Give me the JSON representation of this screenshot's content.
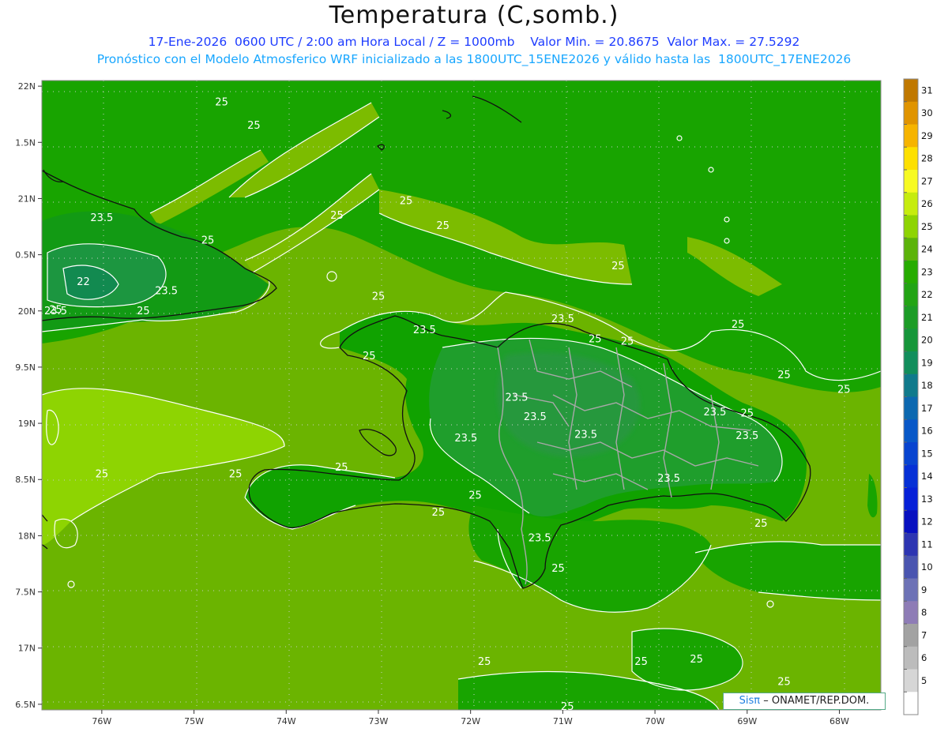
{
  "header": {
    "title": "Temperatura (C,somb.)",
    "subtitle1": "17-Ene-2026  0600 UTC / 2:00 am Hora Local / Z = 1000mb    Valor Min. = 20.8675  Valor Max. = 27.5292",
    "subtitle2": "Pronóstico con el Modelo Atmosferico WRF inicializado a las 1800UTC_15ENE2026 y válido hasta las  1800UTC_17ENE2026"
  },
  "map": {
    "lon_range": [
      -76.65,
      -67.55
    ],
    "lat_range": [
      16.45,
      22.05
    ],
    "lat_ticks": [
      "22N",
      "1.5N",
      "21N",
      "0.5N",
      "20N",
      "9.5N",
      "19N",
      "8.5N",
      "18N",
      "7.5N",
      "17N",
      "6.5N"
    ],
    "lat_tick_values": [
      22,
      21.5,
      21,
      20.5,
      20,
      19.5,
      19,
      18.5,
      18,
      17.5,
      17,
      16.5
    ],
    "lon_ticks": [
      "76W",
      "75W",
      "74W",
      "73W",
      "72W",
      "71W",
      "70W",
      "69W",
      "68W"
    ],
    "lon_tick_values": [
      -76,
      -75,
      -74,
      -73,
      -72,
      -71,
      -70,
      -69,
      -68
    ],
    "contour_labels": [
      {
        "text": "25",
        "lon": -74.7,
        "lat": 21.83
      },
      {
        "text": "25",
        "lon": -74.35,
        "lat": 21.62
      },
      {
        "text": "25",
        "lon": -72.7,
        "lat": 20.95
      },
      {
        "text": "25",
        "lon": -72.3,
        "lat": 20.73
      },
      {
        "text": "25",
        "lon": -73.45,
        "lat": 20.82
      },
      {
        "text": "25",
        "lon": -74.85,
        "lat": 20.6
      },
      {
        "text": "23.5",
        "lon": -76.0,
        "lat": 20.8
      },
      {
        "text": "22",
        "lon": -76.2,
        "lat": 20.23
      },
      {
        "text": "23.5",
        "lon": -75.3,
        "lat": 20.15
      },
      {
        "text": "25",
        "lon": -75.55,
        "lat": 19.97
      },
      {
        "text": "23.5",
        "lon": -76.5,
        "lat": 19.97
      },
      {
        "text": "25",
        "lon": -76.5,
        "lat": 19.98
      },
      {
        "text": "25",
        "lon": -73.0,
        "lat": 20.1
      },
      {
        "text": "23.5",
        "lon": -72.5,
        "lat": 19.8
      },
      {
        "text": "25",
        "lon": -73.1,
        "lat": 19.57
      },
      {
        "text": "23.5",
        "lon": -71.0,
        "lat": 19.9
      },
      {
        "text": "25",
        "lon": -69.1,
        "lat": 19.85
      },
      {
        "text": "25",
        "lon": -70.65,
        "lat": 19.72
      },
      {
        "text": "25",
        "lon": -70.4,
        "lat": 20.37
      },
      {
        "text": "25",
        "lon": -70.3,
        "lat": 19.7
      },
      {
        "text": "25",
        "lon": -68.6,
        "lat": 19.4
      },
      {
        "text": "25",
        "lon": -67.95,
        "lat": 19.27
      },
      {
        "text": "25",
        "lon": -69.0,
        "lat": 19.06
      },
      {
        "text": "23.5",
        "lon": -71.5,
        "lat": 19.2
      },
      {
        "text": "23.5",
        "lon": -71.3,
        "lat": 19.03
      },
      {
        "text": "23.5",
        "lon": -69.35,
        "lat": 19.07
      },
      {
        "text": "23.5",
        "lon": -69.0,
        "lat": 18.86
      },
      {
        "text": "23.5",
        "lon": -72.05,
        "lat": 18.84
      },
      {
        "text": "23.5",
        "lon": -70.75,
        "lat": 18.87
      },
      {
        "text": "23.5",
        "lon": -69.85,
        "lat": 18.48
      },
      {
        "text": "25",
        "lon": -73.4,
        "lat": 18.58
      },
      {
        "text": "25",
        "lon": -74.55,
        "lat": 18.52
      },
      {
        "text": "25",
        "lon": -76.0,
        "lat": 18.52
      },
      {
        "text": "25",
        "lon": -71.95,
        "lat": 18.33
      },
      {
        "text": "25",
        "lon": -72.35,
        "lat": 18.18
      },
      {
        "text": "23.5",
        "lon": -71.25,
        "lat": 17.95
      },
      {
        "text": "25",
        "lon": -71.05,
        "lat": 17.68
      },
      {
        "text": "25",
        "lon": -68.85,
        "lat": 18.08
      },
      {
        "text": "25",
        "lon": -71.85,
        "lat": 16.85
      },
      {
        "text": "25",
        "lon": -70.15,
        "lat": 16.85
      },
      {
        "text": "25",
        "lon": -69.55,
        "lat": 16.87
      },
      {
        "text": "25",
        "lon": -68.6,
        "lat": 16.67
      },
      {
        "text": "25",
        "lon": -70.95,
        "lat": 16.45
      }
    ]
  },
  "colorbar": {
    "labels": [
      "31",
      "30",
      "29",
      "28",
      "27",
      "26",
      "25",
      "24",
      "23",
      "22",
      "21",
      "20",
      "19",
      "18",
      "17",
      "16",
      "15",
      "14",
      "13",
      "12",
      "11",
      "10",
      "9",
      "8",
      "7",
      "6",
      "5"
    ],
    "colors": [
      "#c07800",
      "#e09400",
      "#f6b400",
      "#fde000",
      "#f7fa22",
      "#c6ec0e",
      "#8ed402",
      "#5cb30a",
      "#26ac00",
      "#22a414",
      "#1c9c26",
      "#16963a",
      "#128e5c",
      "#107a8c",
      "#0c68b0",
      "#0858c8",
      "#0844d0",
      "#0630d6",
      "#0620d8",
      "#0810c0",
      "#2d35b2",
      "#4a55b0",
      "#6d72b6",
      "#8e7cb6",
      "#a2a2a2",
      "#bcbcbc",
      "#d6d6d6",
      "#ffffff"
    ]
  },
  "credit": {
    "logo": "Sisπ",
    "text": "– ONAMET/REP.DOM."
  }
}
